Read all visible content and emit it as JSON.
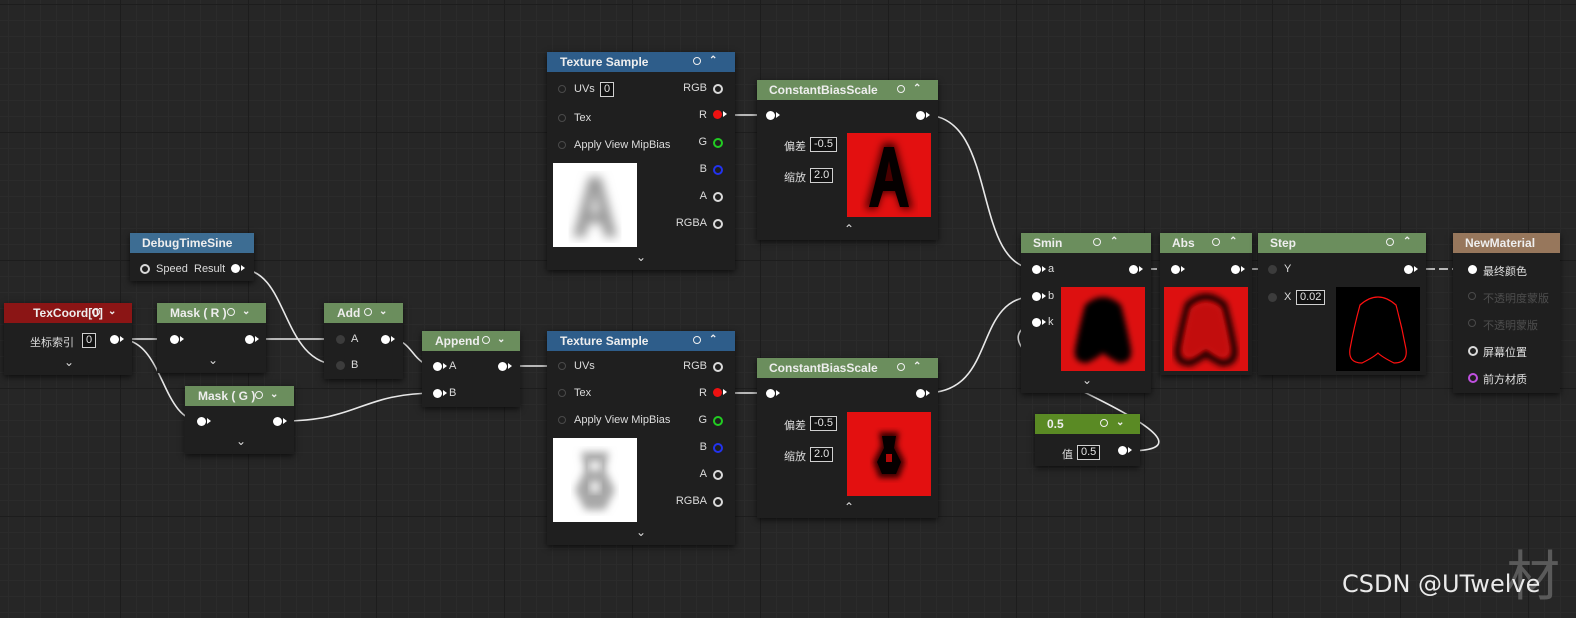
{
  "colors": {
    "background": "#262626",
    "header_green": "#6b8e5d",
    "header_blue": "#2e5d8a",
    "header_texcoord": "#8b1515",
    "header_debug": "#3d6d93",
    "header_const": "#5a8a24",
    "header_result": "#97775c",
    "wire": "#e8e8e8"
  },
  "nodes": {
    "texcoord": {
      "title": "TexCoord[0]",
      "param_label": "坐标索引",
      "param_value": "0"
    },
    "debug_time_sine": {
      "title": "DebugTimeSine",
      "in_label": "Speed",
      "out_label": "Result"
    },
    "mask_r": {
      "title": "Mask ( R )"
    },
    "mask_g": {
      "title": "Mask ( G )"
    },
    "add": {
      "title": "Add",
      "a": "A",
      "b": "B"
    },
    "append": {
      "title": "Append",
      "a": "A",
      "b": "B"
    },
    "texture_sample_1": {
      "title": "Texture Sample",
      "uvs": "UVs",
      "uvs_value": "0",
      "tex": "Tex",
      "mip": "Apply View MipBias",
      "rgb": "RGB",
      "r": "R",
      "g": "G",
      "b": "B",
      "a": "A",
      "rgba": "RGBA"
    },
    "texture_sample_2": {
      "title": "Texture Sample",
      "uvs": "UVs",
      "tex": "Tex",
      "mip": "Apply View MipBias",
      "rgb": "RGB",
      "r": "R",
      "g": "G",
      "b": "B",
      "a": "A",
      "rgba": "RGBA"
    },
    "cbs_1": {
      "title": "ConstantBiasScale",
      "bias_label": "偏差",
      "bias": "-0.5",
      "scale_label": "缩放",
      "scale": "2.0"
    },
    "cbs_2": {
      "title": "ConstantBiasScale",
      "bias_label": "偏差",
      "bias": "-0.5",
      "scale_label": "缩放",
      "scale": "2.0"
    },
    "smin": {
      "title": "Smin",
      "a": "a",
      "b": "b",
      "k": "k"
    },
    "abs": {
      "title": "Abs"
    },
    "step": {
      "title": "Step",
      "y": "Y",
      "x": "X",
      "x_value": "0.02"
    },
    "constant": {
      "title": "0.5",
      "label": "值",
      "value": "0.5"
    },
    "new_material": {
      "title": "NewMaterial",
      "pins": [
        "最终颜色",
        "不透明度蒙版",
        "不透明蒙版",
        "屏幕位置",
        "前方材质"
      ]
    }
  },
  "watermark": {
    "char": "材",
    "text": "CSDN @UTwelve"
  }
}
